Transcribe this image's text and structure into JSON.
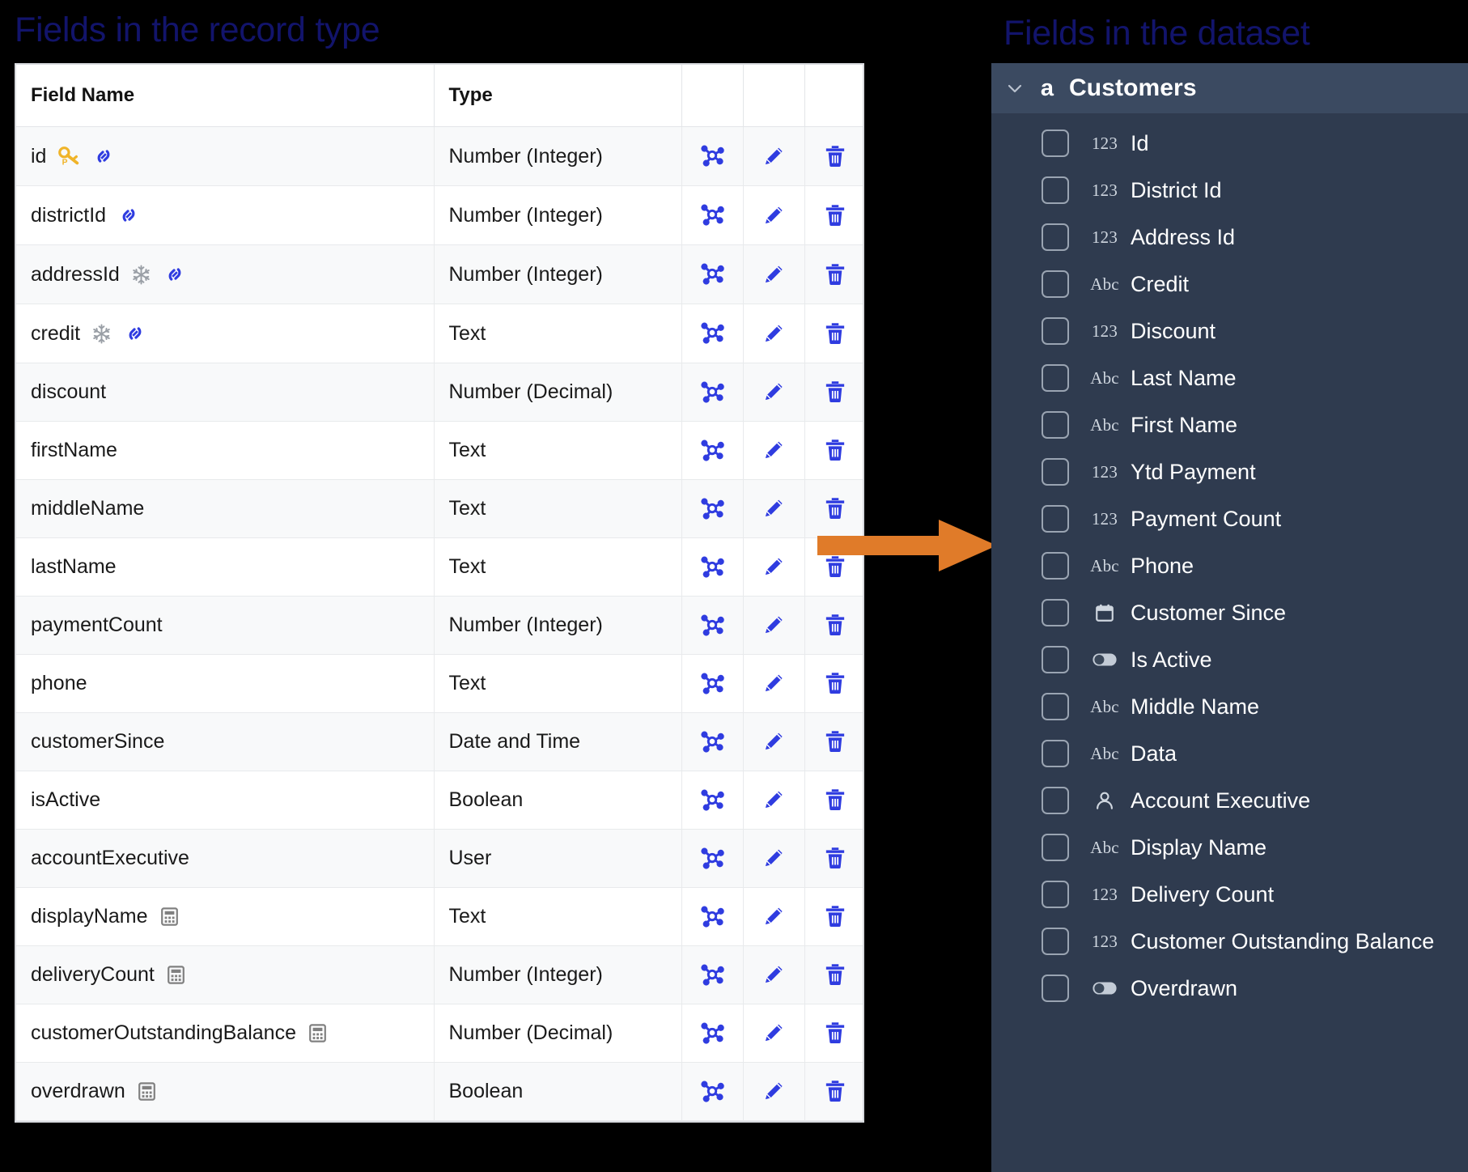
{
  "headings": {
    "left": "Fields in the record type",
    "right": "Fields in the dataset"
  },
  "colors": {
    "heading": "#12146b",
    "action_icon": "#2f3ce0",
    "key_icon": "#f0b429",
    "calc_icon": "#808080",
    "arrow": "#e07b29",
    "panel_bg": "#2f3b4f",
    "panel_header_bg": "#3b4a61"
  },
  "record_type_table": {
    "columns": [
      "Field Name",
      "Type",
      "",
      "",
      ""
    ],
    "row_actions": [
      "relationship-icon",
      "edit-icon",
      "delete-icon"
    ],
    "rows": [
      {
        "name": "id",
        "type": "Number (Integer)",
        "badges": [
          "primary-key-icon",
          "link-icon"
        ]
      },
      {
        "name": "districtId",
        "type": "Number (Integer)",
        "badges": [
          "link-icon"
        ]
      },
      {
        "name": "addressId",
        "type": "Number (Integer)",
        "badges": [
          "snowflake-icon",
          "link-icon"
        ]
      },
      {
        "name": "credit",
        "type": "Text",
        "badges": [
          "snowflake-icon",
          "link-icon"
        ]
      },
      {
        "name": "discount",
        "type": "Number (Decimal)",
        "badges": []
      },
      {
        "name": "firstName",
        "type": "Text",
        "badges": []
      },
      {
        "name": "middleName",
        "type": "Text",
        "badges": []
      },
      {
        "name": "lastName",
        "type": "Text",
        "badges": []
      },
      {
        "name": "paymentCount",
        "type": "Number (Integer)",
        "badges": []
      },
      {
        "name": "phone",
        "type": "Text",
        "badges": []
      },
      {
        "name": "customerSince",
        "type": "Date and Time",
        "badges": []
      },
      {
        "name": "isActive",
        "type": "Boolean",
        "badges": []
      },
      {
        "name": "accountExecutive",
        "type": "User",
        "badges": []
      },
      {
        "name": "displayName",
        "type": "Text",
        "badges": [
          "calculator-icon"
        ]
      },
      {
        "name": "deliveryCount",
        "type": "Number (Integer)",
        "badges": [
          "calculator-icon"
        ]
      },
      {
        "name": "customerOutstandingBalance",
        "type": "Number (Decimal)",
        "badges": [
          "calculator-icon"
        ]
      },
      {
        "name": "overdrawn",
        "type": "Boolean",
        "badges": [
          "calculator-icon"
        ]
      }
    ]
  },
  "dataset_panel": {
    "title": "Customers",
    "expand_icon": "chevron-down-icon",
    "dataset_icon": "a",
    "fields": [
      {
        "label": "Id",
        "type_icon": "123",
        "checked": false
      },
      {
        "label": "District Id",
        "type_icon": "123",
        "checked": false
      },
      {
        "label": "Address Id",
        "type_icon": "123",
        "checked": false
      },
      {
        "label": "Credit",
        "type_icon": "Abc",
        "checked": false
      },
      {
        "label": "Discount",
        "type_icon": "123",
        "checked": false
      },
      {
        "label": "Last Name",
        "type_icon": "Abc",
        "checked": false
      },
      {
        "label": "First Name",
        "type_icon": "Abc",
        "checked": false
      },
      {
        "label": "Ytd Payment",
        "type_icon": "123",
        "checked": false
      },
      {
        "label": "Payment Count",
        "type_icon": "123",
        "checked": false
      },
      {
        "label": "Phone",
        "type_icon": "Abc",
        "checked": false
      },
      {
        "label": "Customer Since",
        "type_icon": "calendar-icon",
        "checked": false
      },
      {
        "label": "Is Active",
        "type_icon": "toggle-icon",
        "checked": false
      },
      {
        "label": "Middle Name",
        "type_icon": "Abc",
        "checked": false
      },
      {
        "label": "Data",
        "type_icon": "Abc",
        "checked": false
      },
      {
        "label": "Account Executive",
        "type_icon": "user-icon",
        "checked": false
      },
      {
        "label": "Display Name",
        "type_icon": "Abc",
        "checked": false
      },
      {
        "label": "Delivery Count",
        "type_icon": "123",
        "checked": false
      },
      {
        "label": "Customer Outstanding Balance",
        "type_icon": "123",
        "checked": false
      },
      {
        "label": "Overdrawn",
        "type_icon": "toggle-icon",
        "checked": false
      }
    ]
  },
  "arrow": {
    "name": "mapping-arrow",
    "direction": "right"
  }
}
